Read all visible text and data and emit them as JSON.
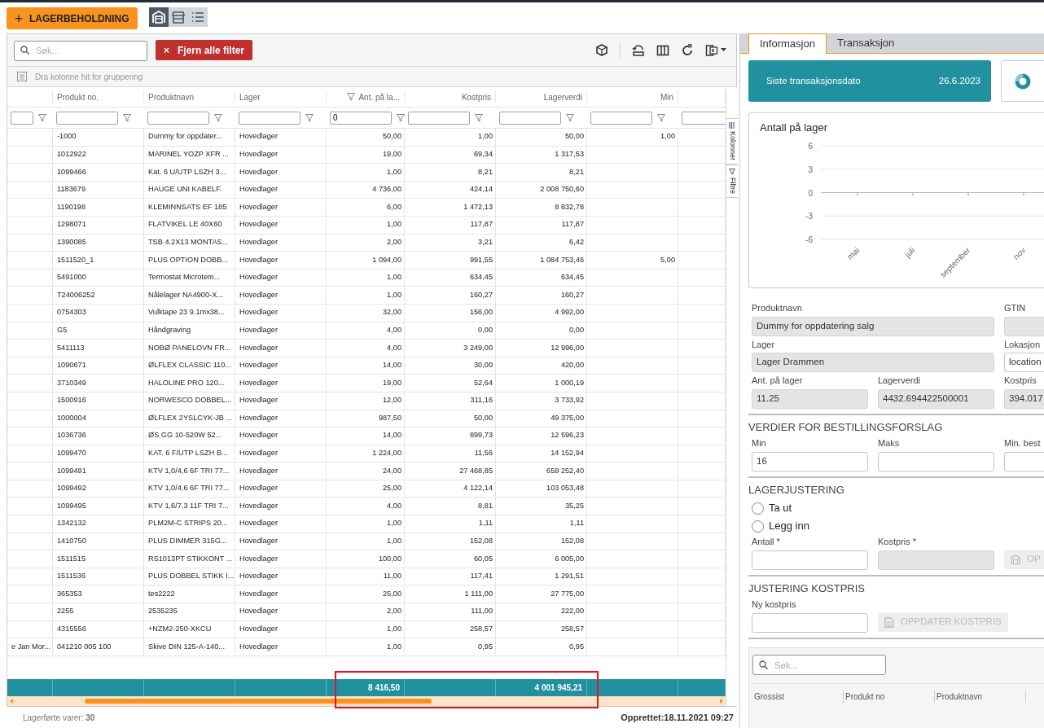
{
  "toolbar": {
    "add_icon": "+",
    "add_button": "LAGERBEHOLDNING",
    "views": [
      {
        "kind": "warehouse",
        "selected": true
      },
      {
        "kind": "shop",
        "selected": false
      },
      {
        "kind": "list",
        "selected": false
      }
    ]
  },
  "grid": {
    "search": {
      "placeholder": "Søk..."
    },
    "clear_icon": "×",
    "clear_filters_button": "Fjern alle filter",
    "group_hint": "Dra kolonne hit for gruppering",
    "tools": [
      {
        "kind": "cube"
      },
      {
        "kind": "reset"
      },
      {
        "kind": "columns"
      },
      {
        "kind": "refresh"
      },
      {
        "kind": "excel"
      }
    ],
    "columns": [
      {
        "kind": "text"
      },
      {
        "kind": "text",
        "label": "Produkt no."
      },
      {
        "kind": "text",
        "label": "Produktnavn"
      },
      {
        "kind": "text",
        "label": "Lager"
      },
      {
        "kind": "number",
        "label": "Ant. på la...",
        "filter_active": true,
        "filter_value": "0"
      },
      {
        "kind": "number",
        "label": "Kostpris",
        "filter_active": false
      },
      {
        "kind": "number",
        "label": "Lagerverdi",
        "filter_active": false
      },
      {
        "kind": "number",
        "label": "Min",
        "filter_active": false
      },
      {
        "kind": "number"
      }
    ],
    "rows": [
      {
        "product_no": "-1000",
        "name": "Dummy for oppdater...",
        "warehouse": "Hovedlager",
        "qty": "50,00",
        "cost": "1,00",
        "value": "50,00",
        "min": "1,00"
      },
      {
        "product_no": "1012922",
        "name": "MARINEL YOZP XFR ...",
        "warehouse": "Hovedlager",
        "qty": "19,00",
        "cost": "69,34",
        "value": "1 317,53"
      },
      {
        "product_no": "1099466",
        "name": "Kat. 6 U/UTP LSZH 3...",
        "warehouse": "Hovedlager",
        "qty": "1,00",
        "cost": "8,21",
        "value": "8,21"
      },
      {
        "product_no": "1183679",
        "name": "HAUGE UNI KABELF.",
        "warehouse": "Hovedlager",
        "qty": "4 736,00",
        "cost": "424,14",
        "value": "2 008 750,60"
      },
      {
        "product_no": "1190198",
        "name": "KLEMINNSATS EF 185",
        "warehouse": "Hovedlager",
        "qty": "6,00",
        "cost": "1 472,13",
        "value": "8 832,78"
      },
      {
        "product_no": "1298071",
        "name": "FLATVIKEL LE 40X60",
        "warehouse": "Hovedlager",
        "qty": "1,00",
        "cost": "117,87",
        "value": "117,87"
      },
      {
        "product_no": "1390085",
        "name": "TSB 4.2X13 MONTAS...",
        "warehouse": "Hovedlager",
        "qty": "2,00",
        "cost": "3,21",
        "value": "6,42"
      },
      {
        "product_no": "1511520_1",
        "name": "PLUS OPTION DOBB...",
        "warehouse": "Hovedlager",
        "qty": "1 094,00",
        "cost": "991,55",
        "value": "1 084 753,46",
        "min": "5,00"
      },
      {
        "product_no": "5491000",
        "name": "Termostat Microtem...",
        "warehouse": "Hovedlager",
        "qty": "1,00",
        "cost": "634,45",
        "value": "634,45"
      },
      {
        "product_no": "T24006252",
        "name": "Nålelager NA4900-X...",
        "warehouse": "Hovedlager",
        "qty": "1,00",
        "cost": "160,27",
        "value": "160,27"
      },
      {
        "product_no": "0754303",
        "name": "Vulktape 23 9.1mx38...",
        "warehouse": "Hovedlager",
        "qty": "32,00",
        "cost": "156,00",
        "value": "4 992,00"
      },
      {
        "product_no": "G5",
        "name": "Håndgraving",
        "warehouse": "Hovedlager",
        "qty": "4,00",
        "cost": "0,00",
        "value": "0,00"
      },
      {
        "product_no": "5411113",
        "name": "NOBØ PANELOVN FR...",
        "warehouse": "Hovedlager",
        "qty": "4,00",
        "cost": "3 249,00",
        "value": "12 996,00"
      },
      {
        "product_no": "1090671",
        "name": "ØLFLEX CLASSIC 110...",
        "warehouse": "Hovedlager",
        "qty": "14,00",
        "cost": "30,00",
        "value": "420,00"
      },
      {
        "product_no": "3710349",
        "name": "HALOLINE PRO 120...",
        "warehouse": "Hovedlager",
        "qty": "19,00",
        "cost": "52,64",
        "value": "1 000,19"
      },
      {
        "product_no": "1500916",
        "name": "NORWESCO DOBBEL...",
        "warehouse": "Hovedlager",
        "qty": "12,00",
        "cost": "311,16",
        "value": "3 733,92"
      },
      {
        "product_no": "1000004",
        "name": "ØLFLEX 2YSLCYK-JB ...",
        "warehouse": "Hovedlager",
        "qty": "987,50",
        "cost": "50,00",
        "value": "49 375,00"
      },
      {
        "product_no": "1036736",
        "name": "ØS GG 10-520W 52...",
        "warehouse": "Hovedlager",
        "qty": "14,00",
        "cost": "899,73",
        "value": "12 596,23"
      },
      {
        "product_no": "1099470",
        "name": "KAT. 6 F/UTP LSZH B...",
        "warehouse": "Hovedlager",
        "qty": "1 224,00",
        "cost": "11,56",
        "value": "14 152,94"
      },
      {
        "product_no": "1099491",
        "name": "KTV 1,0/4,6 6F TRI 77...",
        "warehouse": "Hovedlager",
        "qty": "24,00",
        "cost": "27 468,85",
        "value": "659 252,40"
      },
      {
        "product_no": "1099492",
        "name": "KTV 1,0/4,6 6F TRI 77...",
        "warehouse": "Hovedlager",
        "qty": "25,00",
        "cost": "4 122,14",
        "value": "103 053,48"
      },
      {
        "product_no": "1099495",
        "name": "KTV 1,6/7,3 11F TRI 7...",
        "warehouse": "Hovedlager",
        "qty": "4,00",
        "cost": "8,81",
        "value": "35,25"
      },
      {
        "product_no": "1342132",
        "name": "PLM2M-C STRIPS 20...",
        "warehouse": "Hovedlager",
        "qty": "1,00",
        "cost": "1,11",
        "value": "1,11"
      },
      {
        "product_no": "1410750",
        "name": "PLUS DIMMER 315G...",
        "warehouse": "Hovedlager",
        "qty": "1,00",
        "cost": "152,08",
        "value": "152,08"
      },
      {
        "product_no": "1511515",
        "name": "RS1013PT STIKKONT ...",
        "warehouse": "Hovedlager",
        "qty": "100,00",
        "cost": "60,05",
        "value": "6 005,00"
      },
      {
        "product_no": "1511536",
        "name": "PLUS DOBBEL STIKK I...",
        "warehouse": "Hovedlager",
        "qty": "11,00",
        "cost": "117,41",
        "value": "1 291,51"
      },
      {
        "product_no": "365353",
        "name": "tes2222",
        "warehouse": "Hovedlager",
        "qty": "25,00",
        "cost": "1 111,00",
        "value": "27 775,00"
      },
      {
        "product_no": "2255",
        "name": "2535235",
        "warehouse": "Hovedlager",
        "qty": "2,00",
        "cost": "111,00",
        "value": "222,00"
      },
      {
        "product_no": "4315556",
        "name": "+NZM2-250-XKCU",
        "warehouse": "Hovedlager",
        "qty": "1,00",
        "cost": "258,57",
        "value": "258,57"
      },
      {
        "column_1": "e Jan Mor...",
        "product_no": "041210 005 100",
        "name": "Skive DIN 125-A-140...",
        "warehouse": "Hovedlager",
        "qty": "1,00",
        "cost": "0,95",
        "value": "0,95"
      }
    ],
    "totals": {
      "qty": "8 416,50",
      "value": "4 001 945,21"
    },
    "side_tabs": [
      {
        "kind": "columns",
        "label": "Kolonner"
      },
      {
        "kind": "filter",
        "label": "Filtre"
      }
    ]
  },
  "footer": {
    "count": "Lagerførte varer: **30**",
    "created": "Opprettet:18.11.2021 09:27"
  },
  "details": {
    "tabs": [
      {
        "label": "Informasjon",
        "selected": true
      },
      {
        "label": "Transaksjon",
        "selected": false
      }
    ],
    "summary_card": {
      "label": "Siste transaksjonsdato",
      "value": "26.6.2023"
    },
    "chart": {
      "chart_data": {
        "type": "line",
        "title": "Antall på lager",
        "categories": [
          "mai",
          "juli",
          "september",
          "nov"
        ],
        "ylim": [
          -6,
          6
        ],
        "yticks": [
          6,
          3,
          0,
          -3,
          -6
        ]
      }
    },
    "field_rows": [
      [
        {
          "label": "Produktnavn",
          "value": "Dummy for oppdatering salg",
          "disabled": true
        },
        {
          "label": "GTIN",
          "disabled": true
        }
      ],
      [
        {
          "label": "Lager",
          "value": "Lager Drammen",
          "disabled": true
        },
        {
          "label": "Lokasjon",
          "value": "location",
          "disabled": false
        }
      ],
      [
        {
          "label": "Ant. på lager",
          "value": "11.25",
          "disabled": true
        },
        {
          "label": "Lagerverdi",
          "value": "4432.694422500001",
          "disabled": true
        },
        {
          "label": "Kostpris",
          "value": "394.017",
          "disabled": true
        }
      ]
    ],
    "order_values": {
      "title": "VERDIER FOR BESTILLINGSFORSLAG",
      "fields": [
        {
          "label": "Min",
          "value": "16",
          "disabled": false
        },
        {
          "label": "Maks",
          "disabled": false
        },
        {
          "label": "Min. best",
          "disabled": false
        }
      ]
    },
    "adjustment": {
      "title": "LAGERJUSTERING",
      "radios": [
        {
          "label": "Ta ut",
          "selected": false
        },
        {
          "label": "Legg inn",
          "selected": false
        }
      ],
      "fields": [
        {
          "label": "Antall *",
          "disabled": false
        },
        {
          "label": "Kostpris *",
          "disabled": true
        }
      ],
      "button": {
        "label": "OP",
        "disabled": true
      }
    },
    "cost_adjustment": {
      "title": "JUSTERING KOSTPRIS",
      "fields": [
        {
          "label": "Ny kostpris",
          "disabled": false
        }
      ],
      "button": {
        "label": "OPPDATER KOSTPRIS",
        "disabled": true
      }
    },
    "supplier_grid": {
      "search": {
        "placeholder": "Søk..."
      },
      "columns": [
        "Grossist",
        "Produkt no",
        "Produktnavn"
      ]
    }
  }
}
